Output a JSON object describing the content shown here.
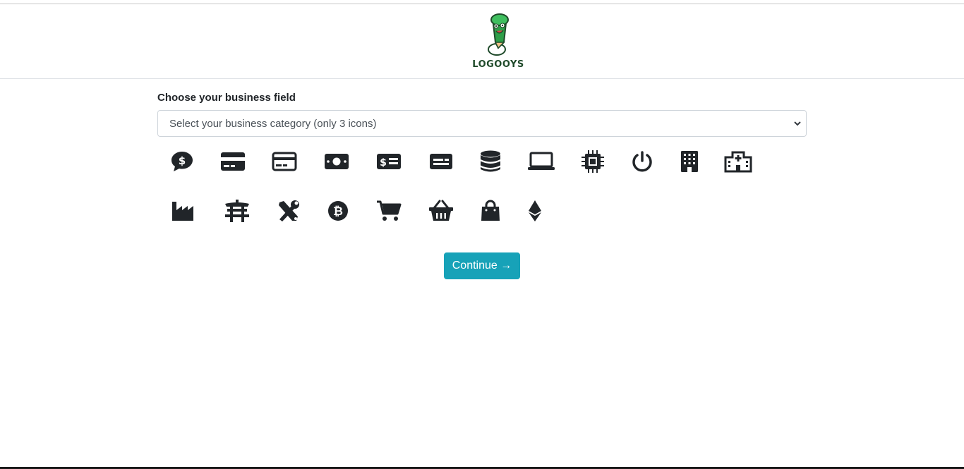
{
  "header": {
    "logo_text": "LOGOOYS"
  },
  "form": {
    "label": "Choose your business field",
    "select_value": "Select your business category (only 3 icons)"
  },
  "icons": {
    "row1": [
      "comment-dollar-icon",
      "credit-card-icon",
      "credit-card-alt-icon",
      "money-bill-icon",
      "money-check-icon",
      "id-card-icon",
      "database-icon",
      "laptop-icon",
      "microchip-icon",
      "power-icon",
      "building-icon",
      "hospital-icon"
    ],
    "row2": [
      "industry-icon",
      "torii-gate-icon",
      "tools-icon",
      "bitcoin-icon",
      "shopping-cart-icon",
      "shopping-basket-icon",
      "shopping-bag-icon",
      "ethereum-icon"
    ]
  },
  "actions": {
    "continue_label": "Continue →"
  },
  "colors": {
    "accent": "#17a2b8",
    "icon": "#212529",
    "logo_green": "#2e9e48"
  }
}
